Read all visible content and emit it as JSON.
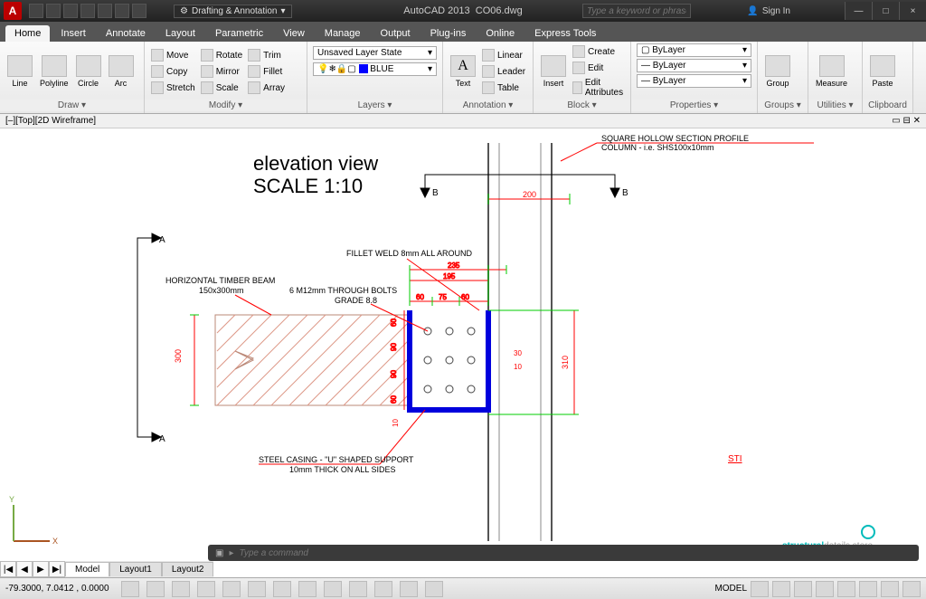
{
  "titlebar": {
    "logo": "A",
    "workspace": "Drafting & Annotation",
    "app": "AutoCAD 2013",
    "file": "CO06.dwg",
    "search_placeholder": "Type a keyword or phrase",
    "signin": "Sign In",
    "min": "—",
    "max": "□",
    "close": "×"
  },
  "tabs": {
    "items": [
      "Home",
      "Insert",
      "Annotate",
      "Layout",
      "Parametric",
      "View",
      "Manage",
      "Output",
      "Plug-ins",
      "Online",
      "Express Tools"
    ]
  },
  "ribbon": {
    "draw": {
      "label": "Draw ▾",
      "line": "Line",
      "polyline": "Polyline",
      "circle": "Circle",
      "arc": "Arc"
    },
    "modify": {
      "label": "Modify ▾",
      "move": "Move",
      "rotate": "Rotate",
      "trim": "Trim",
      "copy": "Copy",
      "mirror": "Mirror",
      "fillet": "Fillet",
      "stretch": "Stretch",
      "scale": "Scale",
      "array": "Array"
    },
    "layers": {
      "label": "Layers ▾",
      "state": "Unsaved Layer State",
      "current": "BLUE"
    },
    "annotation": {
      "label": "Annotation ▾",
      "text": "Text",
      "linear": "Linear",
      "leader": "Leader",
      "table": "Table"
    },
    "block": {
      "label": "Block ▾",
      "insert": "Insert",
      "create": "Create",
      "edit": "Edit",
      "editattr": "Edit Attributes"
    },
    "properties": {
      "label": "Properties ▾",
      "layer": "ByLayer",
      "lt": "ByLayer",
      "lw": "ByLayer"
    },
    "groups": {
      "label": "Groups ▾",
      "group": "Group"
    },
    "utilities": {
      "label": "Utilities ▾",
      "measure": "Measure"
    },
    "clipboard": {
      "label": "Clipboard",
      "paste": "Paste"
    }
  },
  "viewport": {
    "label": "[–][Top][2D Wireframe]"
  },
  "drawing": {
    "title1": "elevation view",
    "title2": "SCALE 1:10",
    "ann_column": "SQUARE HOLLOW SECTION PROFILE",
    "ann_column2": "COLUMN - i.e. SHS100x10mm",
    "ann_fillet": "FILLET WELD 8mm ALL AROUND",
    "ann_beam": "HORIZONTAL TIMBER BEAM",
    "ann_beam2": "150x300mm",
    "ann_bolts": "6 M12mm THROUGH BOLTS",
    "ann_bolts2": "GRADE 8.8",
    "ann_casing": "STEEL CASING - \"U\" SHAPED SUPPORT",
    "ann_casing2": "10mm THICK ON ALL SIDES",
    "dim_200": "200",
    "dim_235": "235",
    "dim_195": "195",
    "dim_60": "60",
    "dim_75": "75",
    "dim_60b": "60",
    "dim_300": "300",
    "dim_310": "310",
    "dim_30": "30",
    "dim_10": "10",
    "dim_10b": "10",
    "dim_60v1": "60",
    "dim_90v1": "90",
    "dim_90v2": "90",
    "dim_60v2": "60",
    "a": "A",
    "b": "B",
    "cursor": "STI",
    "brand1": "structural",
    "brand2": "details store"
  },
  "cmdline": {
    "prompt": "Type a command"
  },
  "sheets": {
    "model": "Model",
    "l1": "Layout1",
    "l2": "Layout2",
    "prev": "◀",
    "next": "▶",
    "first": "|◀",
    "last": "▶|"
  },
  "status": {
    "coords": "-79.3000, 7.0412 , 0.0000",
    "model": "MODEL"
  }
}
